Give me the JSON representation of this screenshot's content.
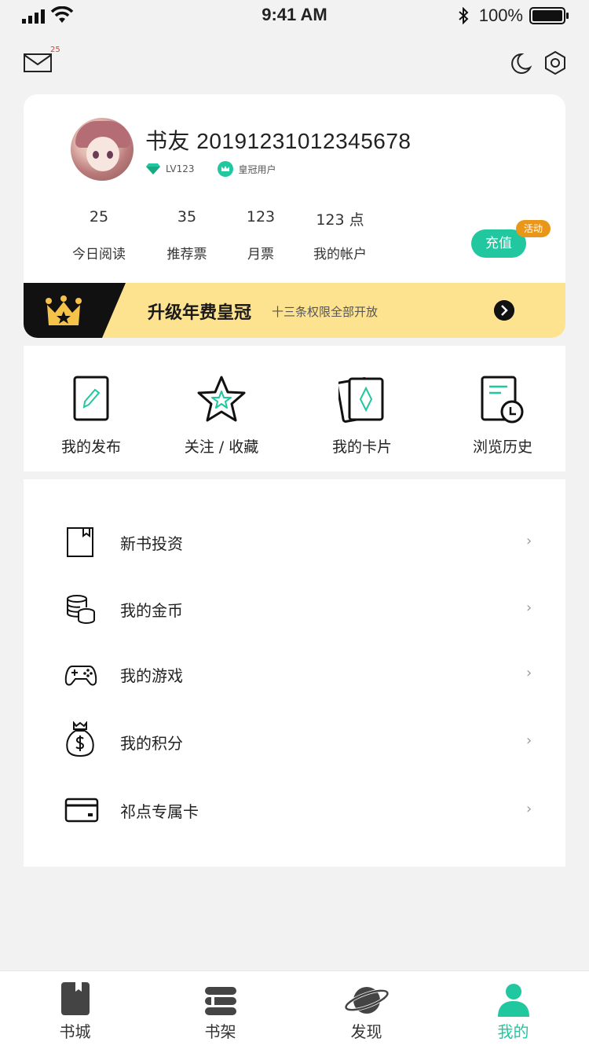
{
  "status_bar": {
    "time": "9:41 AM",
    "battery": "100%",
    "icons": [
      "signal-icon",
      "wifi-icon",
      "bluetooth-icon",
      "battery-icon"
    ]
  },
  "header": {
    "mail_badge": "25",
    "icons": [
      "mail-icon",
      "moon-icon",
      "settings-icon"
    ]
  },
  "profile": {
    "name": "书友 20191231012345678",
    "level": "LV123",
    "membership": "皇冠用户",
    "stats": [
      {
        "value": "25",
        "label": "今日阅读"
      },
      {
        "value": "35",
        "label": "推荐票"
      },
      {
        "value": "123",
        "label": "月票"
      },
      {
        "value": "123 点",
        "label": "我的帐户"
      }
    ],
    "recharge_label": "充值",
    "activity_badge": "活动"
  },
  "crown_banner": {
    "title": "升级年费皇冠",
    "subtitle": "十三条权限全部开放"
  },
  "quick_actions": [
    {
      "label": "我的发布",
      "icon": "pencil-card-icon"
    },
    {
      "label": "关注 / 收藏",
      "icon": "star-icon"
    },
    {
      "label": "我的卡片",
      "icon": "cards-icon"
    },
    {
      "label": "浏览历史",
      "icon": "history-icon"
    }
  ],
  "menu": [
    {
      "label": "新书投资",
      "icon": "book-bookmark-icon"
    },
    {
      "label": "我的金币",
      "icon": "coins-icon"
    },
    {
      "label": "我的游戏",
      "icon": "gamepad-icon"
    },
    {
      "label": "我的积分",
      "icon": "money-bag-icon"
    },
    {
      "label": "祁点专属卡",
      "icon": "credit-card-icon"
    }
  ],
  "tabs": [
    {
      "label": "书城",
      "icon": "bookstore-icon",
      "active": false
    },
    {
      "label": "书架",
      "icon": "bookshelf-icon",
      "active": false
    },
    {
      "label": "发现",
      "icon": "planet-icon",
      "active": false
    },
    {
      "label": "我的",
      "icon": "person-icon",
      "active": true
    }
  ],
  "colors": {
    "accent": "#21c79f",
    "banner": "#fde28f",
    "activity": "#e8971a",
    "badge": "#e53935"
  }
}
